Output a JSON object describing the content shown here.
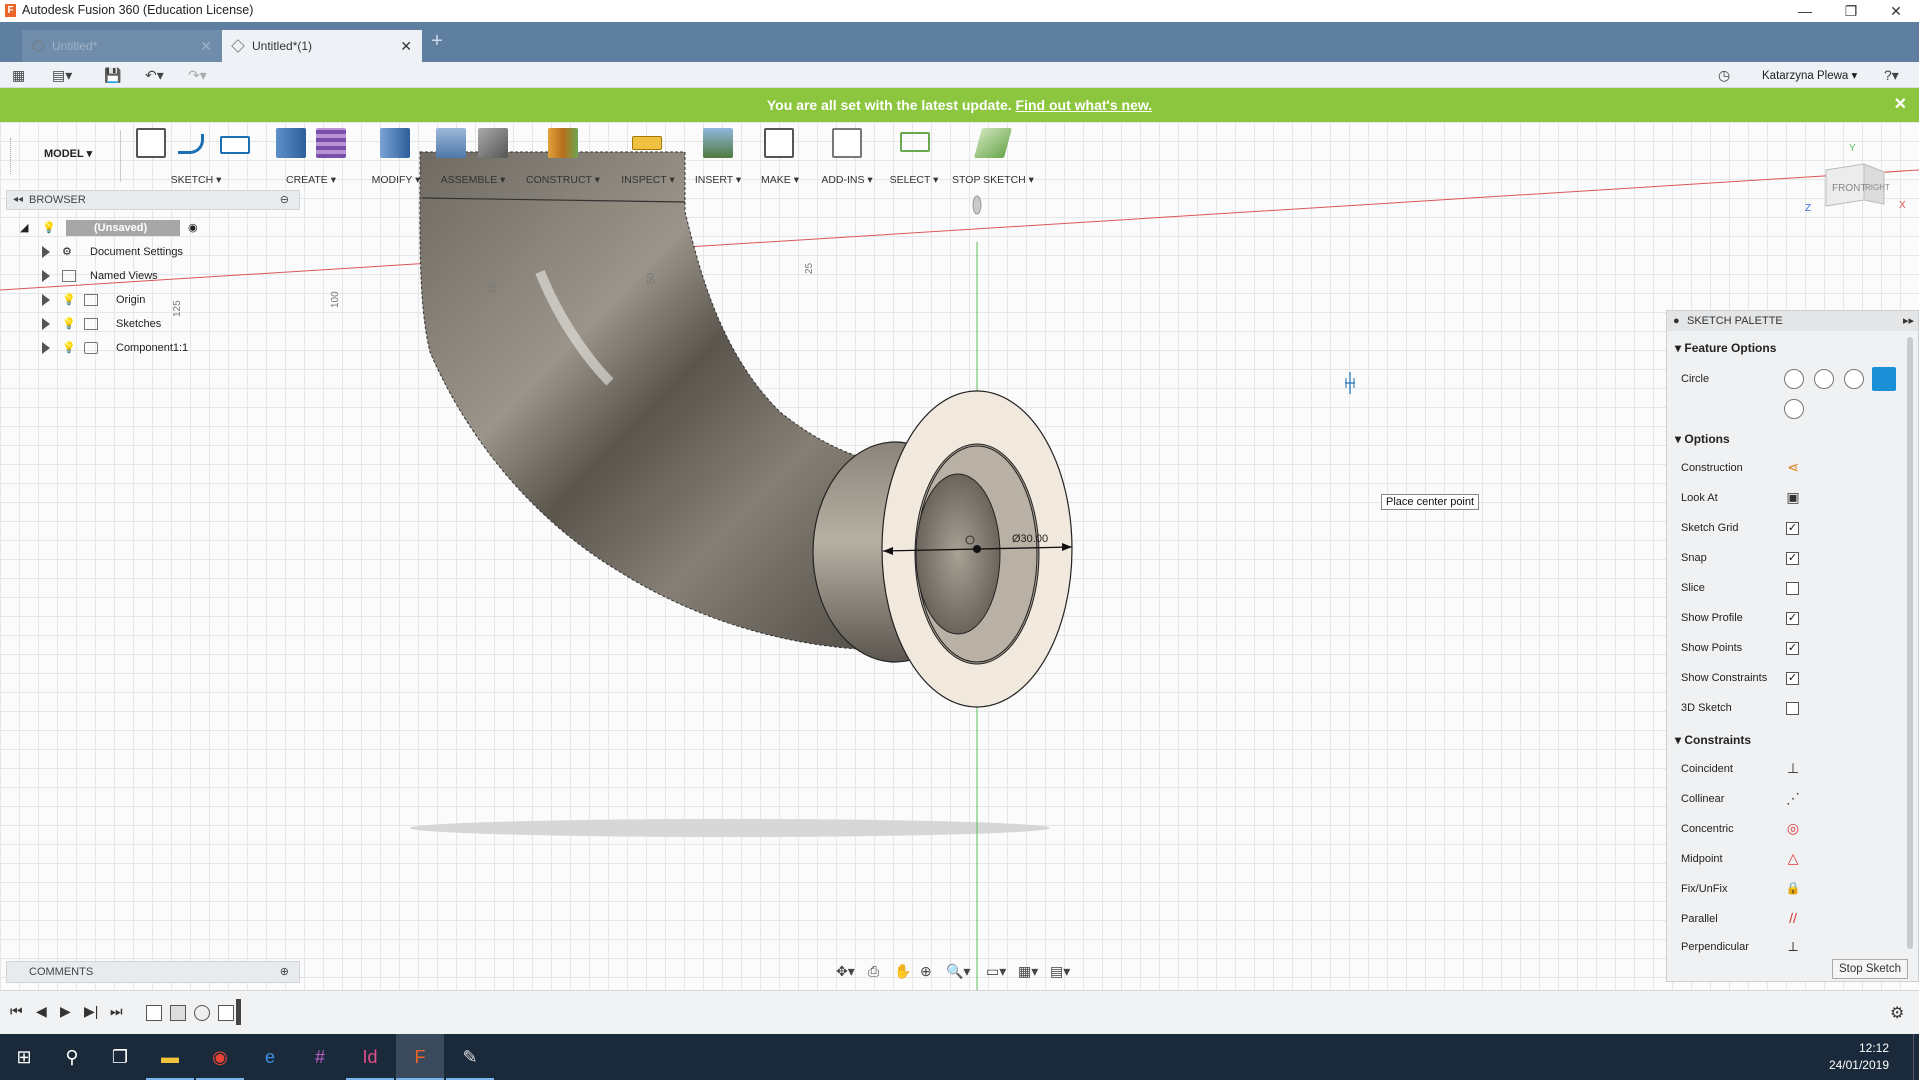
{
  "window": {
    "title": "Autodesk Fusion 360 (Education License)",
    "app_letter": "F"
  },
  "tabs": [
    {
      "label": "Untitled*"
    },
    {
      "label": "Untitled*(1)"
    }
  ],
  "user": {
    "name": "Katarzyna Plewa ▾"
  },
  "banner": {
    "text": "You are all set with the latest update.",
    "link": "Find out what's new."
  },
  "toolbar": {
    "workspace": "MODEL ▾",
    "groups": [
      "SKETCH ▾",
      "CREATE ▾",
      "MODIFY ▾",
      "ASSEMBLE ▾",
      "CONSTRUCT ▾",
      "INSPECT ▾",
      "INSERT ▾",
      "MAKE ▾",
      "ADD-INS ▾",
      "SELECT ▾",
      "STOP SKETCH ▾"
    ]
  },
  "browser": {
    "title": "BROWSER",
    "root": "(Unsaved)",
    "items": [
      "Document Settings",
      "Named Views",
      "Origin",
      "Sketches",
      "Component1:1"
    ]
  },
  "viewport": {
    "ruler_labels": [
      "125",
      "100",
      "75",
      "50",
      "25"
    ],
    "dimension": "Ø30.00",
    "tooltip": "Place center point",
    "viewcube": {
      "front": "FRONT",
      "right": "RIGHT",
      "y": "Y",
      "x": "X",
      "z": "Z"
    }
  },
  "palette": {
    "title": "SKETCH PALETTE",
    "feature_options": "Feature Options",
    "circle_label": "Circle",
    "options_title": "Options",
    "options": [
      {
        "label": "Construction",
        "type": "icon",
        "icon": "construction-icon"
      },
      {
        "label": "Look At",
        "type": "icon",
        "icon": "look-at-icon"
      },
      {
        "label": "Sketch Grid",
        "type": "check",
        "checked": true
      },
      {
        "label": "Snap",
        "type": "check",
        "checked": true
      },
      {
        "label": "Slice",
        "type": "check",
        "checked": false
      },
      {
        "label": "Show Profile",
        "type": "check",
        "checked": true
      },
      {
        "label": "Show Points",
        "type": "check",
        "checked": true
      },
      {
        "label": "Show Constraints",
        "type": "check",
        "checked": true
      },
      {
        "label": "3D Sketch",
        "type": "check",
        "checked": false
      }
    ],
    "constraints_title": "Constraints",
    "constraints": [
      {
        "label": "Coincident",
        "glyph": "⊥"
      },
      {
        "label": "Collinear",
        "glyph": "⋰"
      },
      {
        "label": "Concentric",
        "glyph": "◎"
      },
      {
        "label": "Midpoint",
        "glyph": "△"
      },
      {
        "label": "Fix/UnFix",
        "glyph": "🔒"
      },
      {
        "label": "Parallel",
        "glyph": "//"
      },
      {
        "label": "Perpendicular",
        "glyph": "⟂"
      }
    ],
    "stop_button": "Stop Sketch"
  },
  "comments": {
    "title": "COMMENTS"
  },
  "clock": {
    "time": "12:12",
    "date": "24/01/2019"
  },
  "colors": {
    "banner": "#8cc63f",
    "tabbar": "#5f7fa0",
    "accent": "#1a8fd6",
    "taskbar": "#1b2a3a"
  }
}
